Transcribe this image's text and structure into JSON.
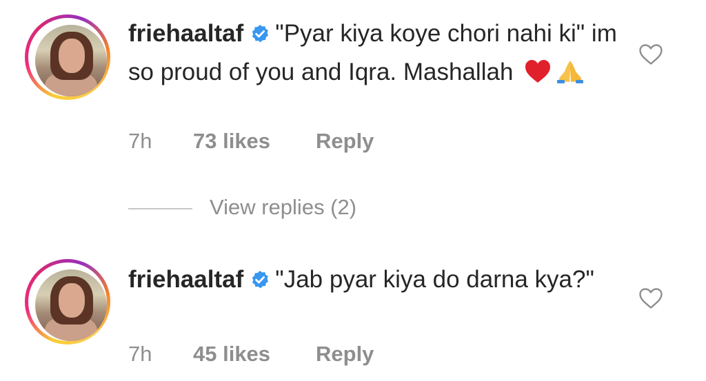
{
  "comments": [
    {
      "username": "friehaaltaf",
      "text": "\"Pyar kiya koye chori nahi ki\" im so proud of you and Iqra. Mashallah",
      "emojis": [
        "❤️",
        "🙏"
      ],
      "time": "7h",
      "likes": "73 likes",
      "reply": "Reply"
    },
    {
      "username": "friehaaltaf",
      "text": "\"Jab pyar kiya do darna kya?\"",
      "time": "7h",
      "likes": "45 likes",
      "reply": "Reply"
    }
  ],
  "view_replies": "View replies (2)",
  "colors": {
    "text": "#262626",
    "muted": "#8e8e8e",
    "verified": "#3897f0",
    "divider": "#c7c7c7"
  },
  "icons": [
    "verified-badge-icon",
    "heart-outline-icon",
    "red-heart-emoji",
    "folded-hands-emoji"
  ]
}
